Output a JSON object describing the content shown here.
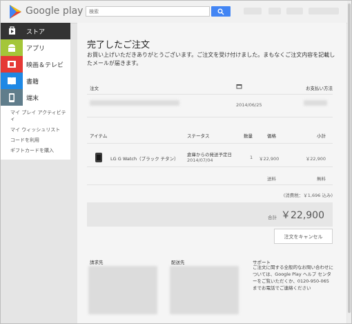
{
  "header": {
    "brand": "Google play",
    "search_placeholder": "検索"
  },
  "sidebar": {
    "items": [
      {
        "label": "ストア",
        "color": "#333333",
        "icon": "store-icon"
      },
      {
        "label": "アプリ",
        "color": "#a4c639",
        "icon": "android-icon"
      },
      {
        "label": "映画＆テレビ",
        "color": "#e53935",
        "icon": "film-icon"
      },
      {
        "label": "書籍",
        "color": "#1e88e5",
        "icon": "book-icon"
      },
      {
        "label": "端末",
        "color": "#607d8b",
        "icon": "device-icon"
      }
    ],
    "links": [
      "マイ プレイ アクティビティ",
      "マイ ウィッシュリスト",
      "コードを利用",
      "ギフトカードを購入"
    ]
  },
  "order": {
    "title": "完了したご注文",
    "message": "お買い上げいただきありがとうございます。ご注文を受け付けました。まもなくご注文内容を記載したメールが届きます。",
    "order_label": "注文",
    "payment_label": "お支払い方法",
    "date": "2014/06/25",
    "columns": {
      "item": "アイテム",
      "status": "ステータス",
      "qty": "数量",
      "price": "価格",
      "subtotal": "小計"
    },
    "line_item": {
      "name": "LG G Watch（ブラック チタン）",
      "status": "倉庫からの発送予定日",
      "status_date": "2014/07/04",
      "qty": "1",
      "price": "￥22,900",
      "subtotal": "￥22,900"
    },
    "shipping_label": "送料",
    "shipping_value": "無料",
    "tax_note": "(消費税：￥1,696 込み)",
    "total_label": "合計",
    "total_value": "￥22,900",
    "cancel_button": "注文をキャンセル",
    "billing_label": "請求先",
    "shipping_to_label": "配送先",
    "support_label": "サポート",
    "support_text": "ご注文に関する全般的なお問い合わせについては、Google Play ヘルプ センターをご覧いただくか、0120-950-065 までお電話でご連絡ください"
  }
}
